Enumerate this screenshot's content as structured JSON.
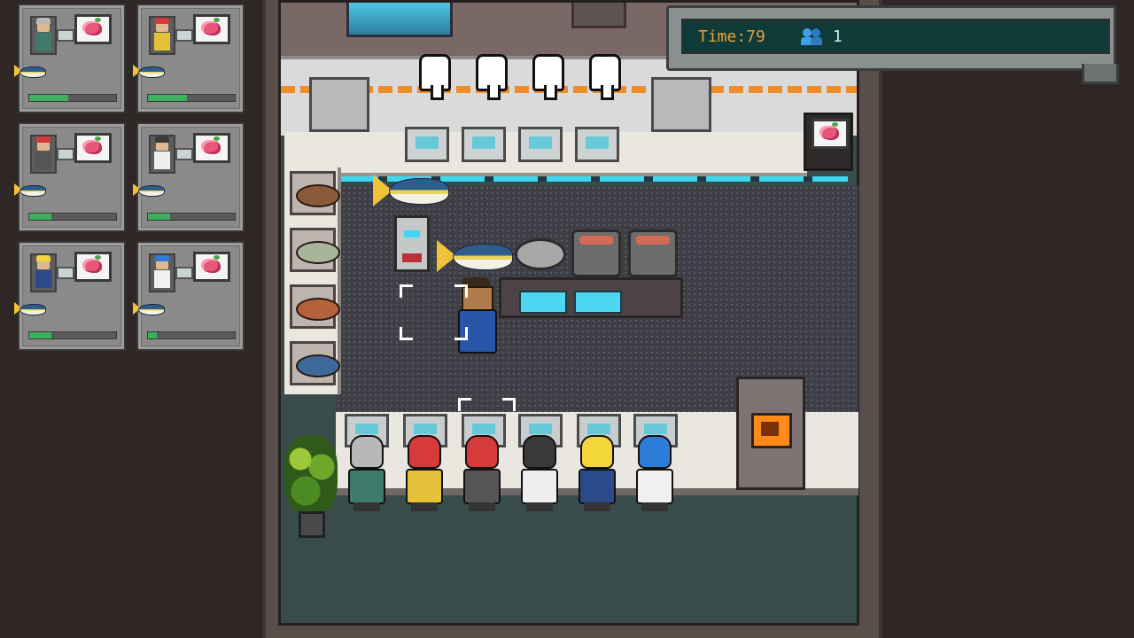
{
  "hud": {
    "time_label": "Time:79",
    "player_count": "1",
    "players_icon": "players-icon"
  },
  "orders": [
    {
      "customer": "gray-hair-customer",
      "hair_color": "#b8b8b8",
      "outfit_color": "#3f7a6a",
      "dish": "tuna-sashimi-icon",
      "ingredient": "tuna-fish-icon",
      "progress": 0.45
    },
    {
      "customer": "red-hair-customer",
      "hair_color": "#d63a3a",
      "outfit_color": "#e6c23a",
      "dish": "tuna-sashimi-icon",
      "ingredient": "tuna-fish-icon",
      "progress": 0.45
    },
    {
      "customer": "red-hair-customer-2",
      "hair_color": "#d63a3a",
      "outfit_color": "#555555",
      "dish": "tuna-sashimi-icon",
      "ingredient": "tuna-fish-icon",
      "progress": 0.25
    },
    {
      "customer": "dark-hair-customer",
      "hair_color": "#3a3a3a",
      "outfit_color": "#eeeeee",
      "dish": "tuna-sashimi-icon",
      "ingredient": "tuna-fish-icon",
      "progress": 0.25
    },
    {
      "customer": "blonde-customer",
      "hair_color": "#f2d63a",
      "outfit_color": "#2a4a8a",
      "dish": "tuna-sashimi-icon",
      "ingredient": "tuna-fish-icon",
      "progress": 0.25
    },
    {
      "customer": "blue-hair-customer",
      "hair_color": "#2d7cd8",
      "outfit_color": "#f0f0f0",
      "dish": "tuna-sashimi-icon",
      "ingredient": "tuna-fish-icon",
      "progress": 0.1
    }
  ],
  "queue": [
    {
      "hair": "#b8b8b8",
      "outfit": "#3f7a6a"
    },
    {
      "hair": "#d63a3a",
      "outfit": "#e6c23a"
    },
    {
      "hair": "#d63a3a",
      "outfit": "#555555"
    },
    {
      "hair": "#3a3a3a",
      "outfit": "#eeeeee"
    },
    {
      "hair": "#f2d63a",
      "outfit": "#2a4a8a"
    },
    {
      "hair": "#2d7cd8",
      "outfit": "#f0f0f0"
    }
  ],
  "colors": {
    "accent_cyan": "#3fd6f0",
    "timer_text": "#e7a23a",
    "progress_green": "#3db05e"
  }
}
